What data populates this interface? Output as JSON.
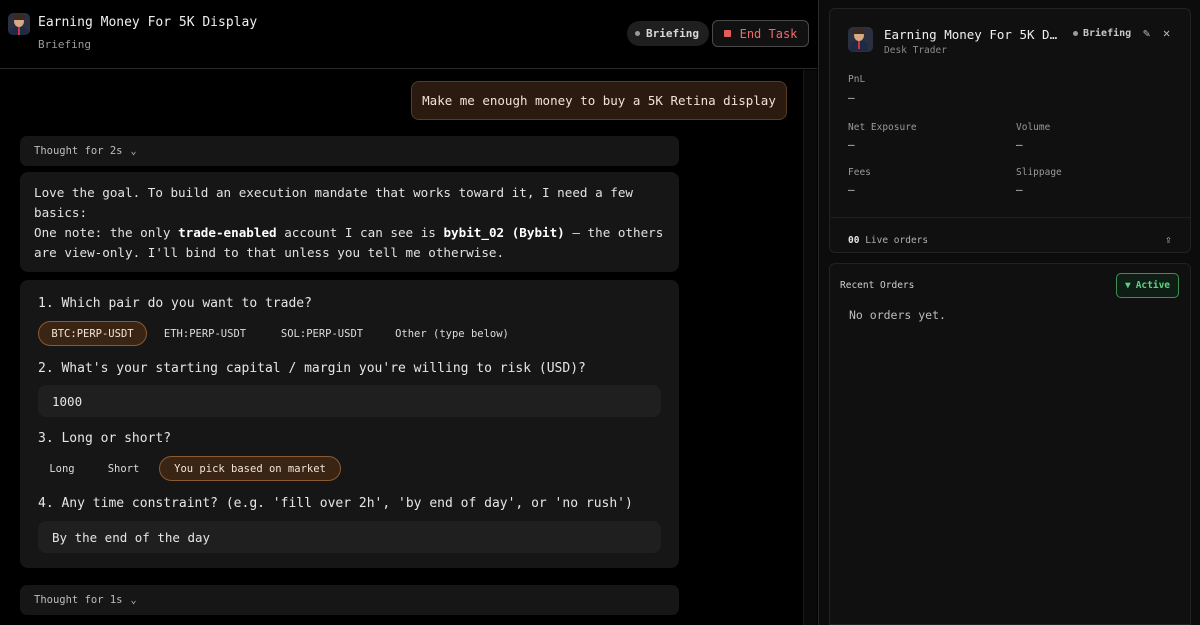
{
  "header": {
    "title": "Earning Money For 5K Display",
    "subtitle": "Briefing",
    "status_pill": "Briefing",
    "end_task_label": "End Task"
  },
  "chat": {
    "user_message": "Make me enough money to buy a 5K Retina display",
    "thought_1": "Thought for 2s",
    "thought_2": "Thought for 1s",
    "reply": {
      "line1": "Love the goal. To build an execution mandate that works toward it, I need a few basics:",
      "note_prefix": "One note: the only ",
      "note_bold1": "trade-enabled",
      "note_mid": " account I can see is ",
      "note_bold2": "bybit_02 (Bybit)",
      "note_suffix": " — the others are view-only. I'll bind to that unless you tell me otherwise."
    },
    "questions": {
      "q1": "1. Which pair do you want to trade?",
      "q1_options": [
        "BTC:PERP-USDT",
        "ETH:PERP-USDT",
        "SOL:PERP-USDT",
        "Other (type below)"
      ],
      "q1_selected": "BTC:PERP-USDT",
      "q2": "2. What's your starting capital / margin you're willing to risk (USD)?",
      "q2_value": "1000",
      "q3": "3. Long or short?",
      "q3_options": [
        "Long",
        "Short",
        "You pick based on market"
      ],
      "q3_selected": "You pick based on market",
      "q4": "4. Any time constraint? (e.g. 'fill over 2h', 'by end of day', or 'no rush')",
      "q4_value": "By the end of the day"
    }
  },
  "panel": {
    "title": "Earning Money For 5K Di…",
    "role": "Desk Trader",
    "status": "Briefing",
    "icons": [
      "pencil-icon",
      "close-icon",
      "share-icon",
      "filter-icon"
    ],
    "metrics": {
      "pnl_label": "PnL",
      "pnl_value": "—",
      "net_exposure_label": "Net Exposure",
      "net_exposure_value": "—",
      "volume_label": "Volume",
      "volume_value": "—",
      "fees_label": "Fees",
      "fees_value": "—",
      "slippage_label": "Slippage",
      "slippage_value": "—"
    },
    "live_orders_count": "00",
    "live_orders_label": "Live orders",
    "recent_orders_title": "Recent Orders",
    "active_label": "Active",
    "no_orders_text": "No orders yet."
  },
  "colors": {
    "accent_orange": "#8a5a33",
    "danger": "#e35d5d",
    "active_green": "#62d185"
  }
}
